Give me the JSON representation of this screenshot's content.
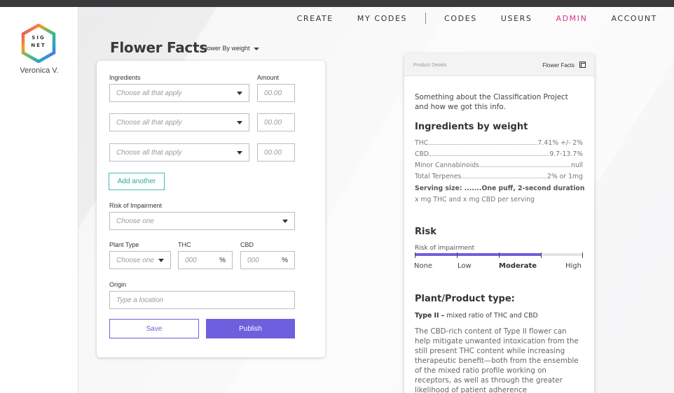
{
  "user": {
    "name": "Veronica V."
  },
  "logo": {
    "letters": [
      "S",
      "I",
      "G",
      "N",
      "E",
      "T"
    ]
  },
  "nav": {
    "create": "CREATE",
    "my_codes": "MY CODES",
    "codes": "CODES",
    "users": "USERS",
    "admin": "ADMIN",
    "account": "ACCOUNT"
  },
  "page": {
    "title": "Flower Facts",
    "mode_select": "Flower By weight"
  },
  "form": {
    "ingredients_label": "Ingredients",
    "amount_label": "Amount",
    "ingredient_placeholder": "Choose all that apply",
    "amount_placeholder": "00.00",
    "add_another": "Add another",
    "risk_label": "Risk of Impairment",
    "risk_placeholder": "Choose one",
    "plant_type_label": "Plant Type",
    "plant_type_placeholder": "Choose one",
    "thc_label": "THC",
    "cbd_label": "CBD",
    "percent_placeholder": "000",
    "percent_unit": "%",
    "origin_label": "Origin",
    "origin_placeholder": "Type a location",
    "save": "Save",
    "publish": "Publish"
  },
  "preview": {
    "header_left": "Product Details",
    "header_right": "Flower Facts",
    "intro": "Something about the Classification Project and how we got this info.",
    "ingredients_heading": "Ingredients by weight",
    "ingredients": [
      {
        "name": "THC",
        "value": "7.41% +/- 2%"
      },
      {
        "name": "CBD",
        "value": "9.7-13.7%"
      },
      {
        "name": "Minor Cannabinoids",
        "value": "null"
      },
      {
        "name": "Total Terpenes",
        "value": "2% or 1mg"
      }
    ],
    "serving": "Serving size: .......One puff, 2-second duration",
    "per_serving": "x mg THC and x mg CBD per serving",
    "risk_heading": "Risk",
    "risk_label": "Risk of impairment",
    "risk_levels": [
      "None",
      "Low",
      "Moderate",
      "High"
    ],
    "risk_selected": "Moderate",
    "risk_fill_fraction": 0.75,
    "type_heading": "Plant/Product type:",
    "type_name": "Type II –",
    "type_desc": "mixed ratio of THC and CBD",
    "description": "The CBD-rich content of Type II flower can help mitigate unwanted intoxication from the still present THC content while increasing therapeutic benefit—both from the ensemble of the mixed ratio profile working on receptors, as well as through the greater likelihood of patient adherence"
  },
  "colors": {
    "accent": "#6e5fdf",
    "admin": "#d6338f",
    "teal": "#3dbfb0"
  }
}
